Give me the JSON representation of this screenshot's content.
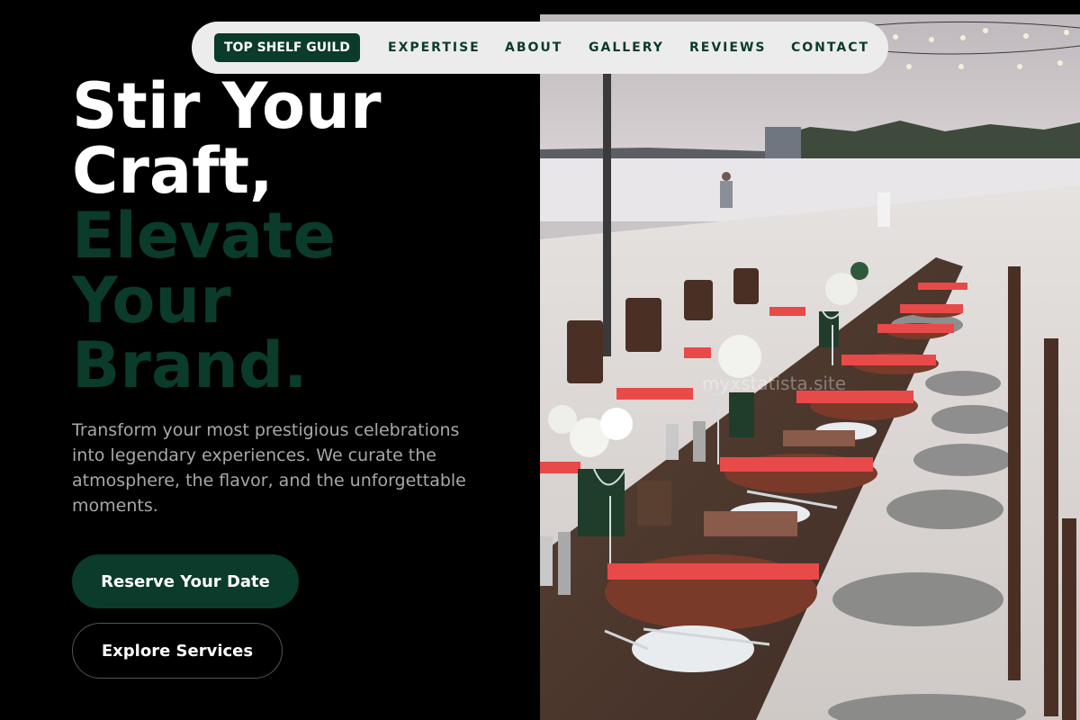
{
  "nav": {
    "brand": "TOP SHELF GUILD",
    "links": [
      "EXPERTISE",
      "ABOUT",
      "GALLERY",
      "REVIEWS",
      "CONTACT"
    ]
  },
  "hero": {
    "headline_line1": "Stir Your",
    "headline_line2": "Craft,",
    "headline_line3": "Elevate",
    "headline_line4": "Your",
    "headline_line5": "Brand.",
    "subcopy": "Transform your most prestigious celebrations into legendary experiences. We curate the atmosphere, the flavor, and the unforgettable moments.",
    "primary_cta": "Reserve Your Date",
    "secondary_cta": "Explore Services"
  },
  "photo": {
    "watermark": "myxstatista.site",
    "subject": "beach-dinner-table-photo"
  },
  "colors": {
    "accent_green": "#0b3b2a",
    "background": "#000000",
    "nav_background": "#ececec",
    "subcopy_gray": "#a8a8a8"
  }
}
